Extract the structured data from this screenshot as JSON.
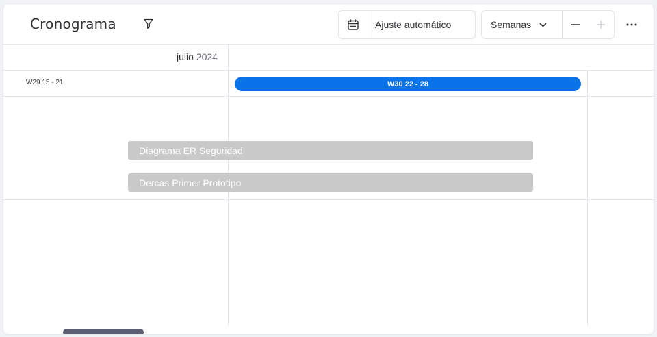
{
  "header": {
    "title": "Cronograma",
    "autofit_label": "Ajuste automático",
    "scale_selected": "Semanas"
  },
  "icons": {
    "filter": "filter-icon",
    "calendar": "calendar-icon",
    "chevron": "chevron-down-icon",
    "zoom_out": "minus-icon",
    "zoom_in": "plus-icon",
    "more": "more-horizontal-icon"
  },
  "timeline": {
    "month_name": "julio",
    "month_year": "2024",
    "weeks": [
      {
        "label": "W29 15 - 21"
      },
      {
        "label": "W30 22 - 28"
      }
    ],
    "current_week_index": 1,
    "tasks": [
      {
        "label": "Diagrama ER Seguridad"
      },
      {
        "label": "Dercas Primer Prototipo"
      }
    ]
  },
  "colors": {
    "current_week": "#0a73ea",
    "task_bar": "#c9c9c9",
    "scrollbar": "#5c5f73"
  }
}
